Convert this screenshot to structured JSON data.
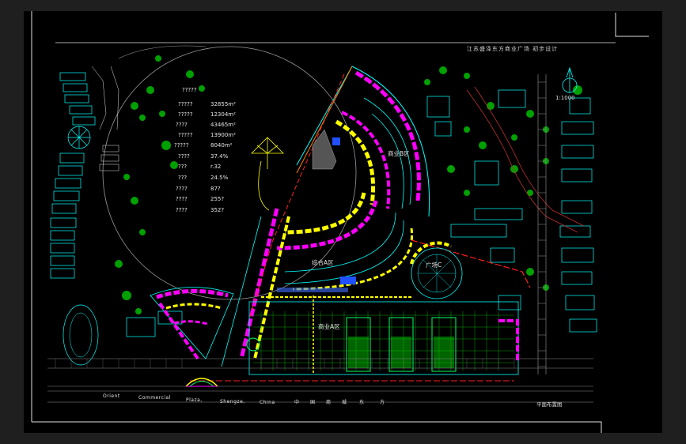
{
  "title": "江苏盛泽东方商业广场 初步设计",
  "scale": "1:1000",
  "stats": [
    {
      "label": "?????",
      "value": ""
    },
    {
      "label": "?????",
      "value": "32855m²"
    },
    {
      "label": "?????",
      "value": "12304m²"
    },
    {
      "label": "????",
      "value": "43465m²"
    },
    {
      "label": "?????",
      "value": "13900m²"
    },
    {
      "label": "?????",
      "value": "8040m²"
    },
    {
      "label": "????",
      "value": "37.4%"
    },
    {
      "label": "???",
      "value": "r.32"
    },
    {
      "label": "???",
      "value": "24.5%"
    },
    {
      "label": "????",
      "value": "87?"
    },
    {
      "label": "????",
      "value": "255?"
    },
    {
      "label": "????",
      "value": "352?"
    }
  ],
  "zones": {
    "north": "商业B区",
    "middle": "综合A区",
    "south": "商业A区",
    "circle": "广场C"
  },
  "road_text": [
    "Orient",
    "Commercial",
    "Plaza,",
    "Shengze,",
    "China",
    "中",
    "国",
    "商",
    "城",
    "东",
    "方"
  ],
  "plan_label": "平面布置图",
  "colors": {
    "background": "#000000",
    "magenta": "#ff00ff",
    "yellow": "#ffff00",
    "cyan": "#00ffff",
    "green": "#00c800",
    "red": "#ff2020",
    "white": "#e8e8e8"
  }
}
